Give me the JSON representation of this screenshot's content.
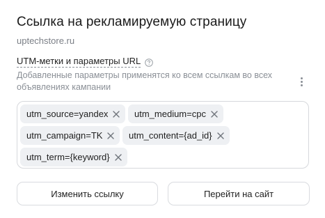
{
  "header": {
    "title": "Ссылка на рекламируемую страницу",
    "site": "uptechstore.ru"
  },
  "utm": {
    "label": "UTM-метки и параметры URL",
    "help_icon": "question-circle-icon",
    "description": "Добавленные параметры применятся ко всем ссылкам во всех объявлениях кампании",
    "menu_icon": "kebab-menu-icon",
    "tags": [
      {
        "label": "utm_source=yandex"
      },
      {
        "label": "utm_medium=cpc"
      },
      {
        "label": "utm_campaign=TK"
      },
      {
        "label": "utm_content={ad_id}"
      },
      {
        "label": "utm_term={keyword}"
      }
    ],
    "remove_icon": "close-icon"
  },
  "actions": {
    "edit_label": "Изменить ссылку",
    "go_label": "Перейти на сайт"
  }
}
